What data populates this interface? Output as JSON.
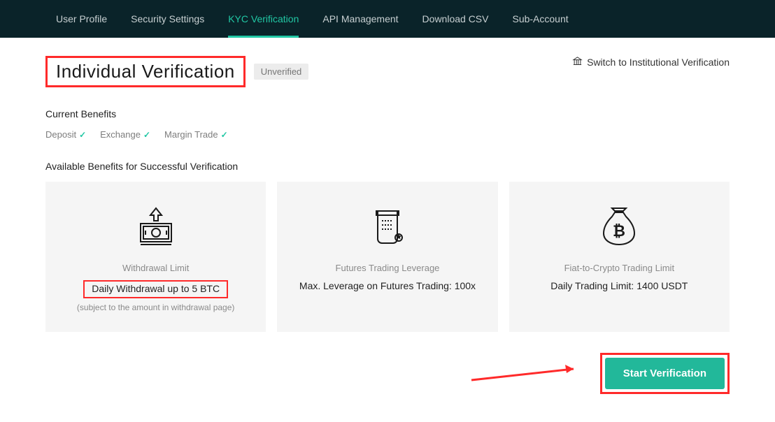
{
  "nav": {
    "items": [
      "User Profile",
      "Security Settings",
      "KYC Verification",
      "API Management",
      "Download CSV",
      "Sub-Account"
    ],
    "active_index": 2
  },
  "header": {
    "title": "Individual Verification",
    "status_badge": "Unverified",
    "switch_label": "Switch to Institutional Verification"
  },
  "current_benefits": {
    "heading": "Current Benefits",
    "items": [
      "Deposit",
      "Exchange",
      "Margin Trade"
    ]
  },
  "available": {
    "heading": "Available Benefits for Successful Verification",
    "cards": [
      {
        "icon": "withdrawal",
        "title": "Withdrawal Limit",
        "value": "Daily Withdrawal up to 5 BTC",
        "sub": "(subject to the amount in withdrawal page)",
        "highlight_value": true
      },
      {
        "icon": "scroll",
        "title": "Futures Trading Leverage",
        "value": "Max. Leverage on Futures Trading: 100x",
        "sub": "",
        "highlight_value": false
      },
      {
        "icon": "moneybag",
        "title": "Fiat-to-Crypto Trading Limit",
        "value": "Daily Trading Limit: 1400 USDT",
        "sub": "",
        "highlight_value": false
      }
    ]
  },
  "action": {
    "button_label": "Start Verification"
  },
  "colors": {
    "accent": "#21c7a4",
    "highlight": "#ff2a2a"
  }
}
